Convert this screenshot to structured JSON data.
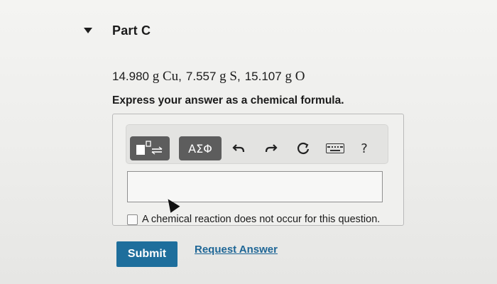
{
  "part": {
    "title": "Part C",
    "caret_icon": "caret-down-icon"
  },
  "question": {
    "items": [
      {
        "mass": "14.980",
        "unit": "g",
        "element": "Cu",
        "sep": ","
      },
      {
        "mass": "7.557",
        "unit": "g",
        "element": "S",
        "sep": ","
      },
      {
        "mass": "15.107",
        "unit": "g",
        "element": "O",
        "sep": ""
      }
    ],
    "instruction": "Express your answer as a chemical formula."
  },
  "toolbar": {
    "templates_icon": "templates-icon",
    "symbols_label": "ΑΣΦ",
    "undo_icon": "undo-icon",
    "redo_icon": "redo-icon",
    "reset_icon": "reset-icon",
    "keyboard_icon": "keyboard-icon",
    "help_label": "?"
  },
  "answer": {
    "value": "",
    "no_reaction_label": "A chemical reaction does not occur for this question.",
    "no_reaction_checked": false
  },
  "actions": {
    "submit_label": "Submit",
    "request_label": "Request Answer"
  },
  "colors": {
    "accent": "#1e6e9c",
    "toolbar_button": "#5d5d5d",
    "link": "#1e6696"
  }
}
